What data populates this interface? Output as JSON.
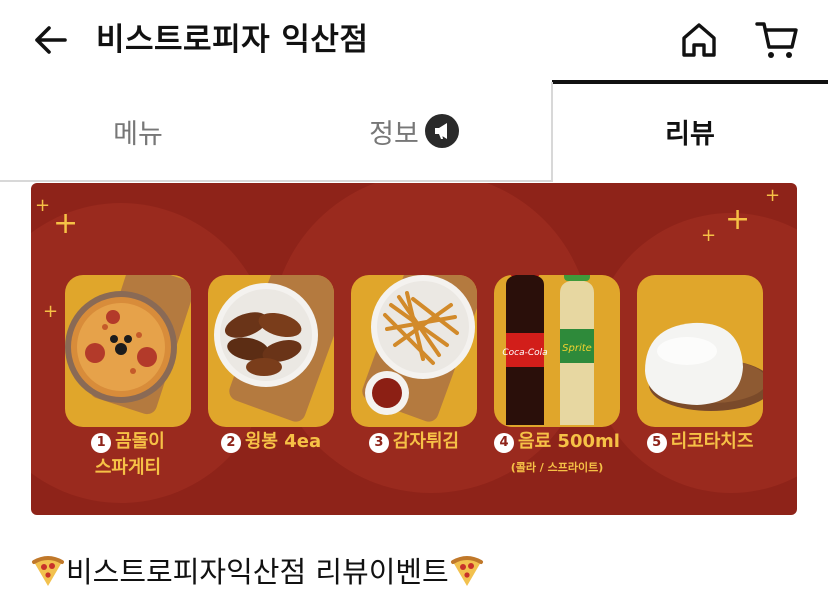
{
  "header": {
    "title": "비스트로피자 익산점"
  },
  "tabs": [
    {
      "label": "메뉴"
    },
    {
      "label": "정보"
    },
    {
      "label": "리뷰"
    }
  ],
  "banner": {
    "items": [
      {
        "number": "1",
        "label": "곰돌이",
        "label2": "스파게티"
      },
      {
        "number": "2",
        "label": "윙봉 4ea"
      },
      {
        "number": "3",
        "label": "감자튀김"
      },
      {
        "number": "4",
        "label": "음료 500ml",
        "sub": "(콜라 / 스프라이트)"
      },
      {
        "number": "5",
        "label": "리코타치즈"
      }
    ],
    "colors": {
      "background": "#8e2319",
      "card": "#e0a62b",
      "text": "#f6c146"
    }
  },
  "event": {
    "title": "비스트로피자익산점 리뷰이벤트"
  }
}
